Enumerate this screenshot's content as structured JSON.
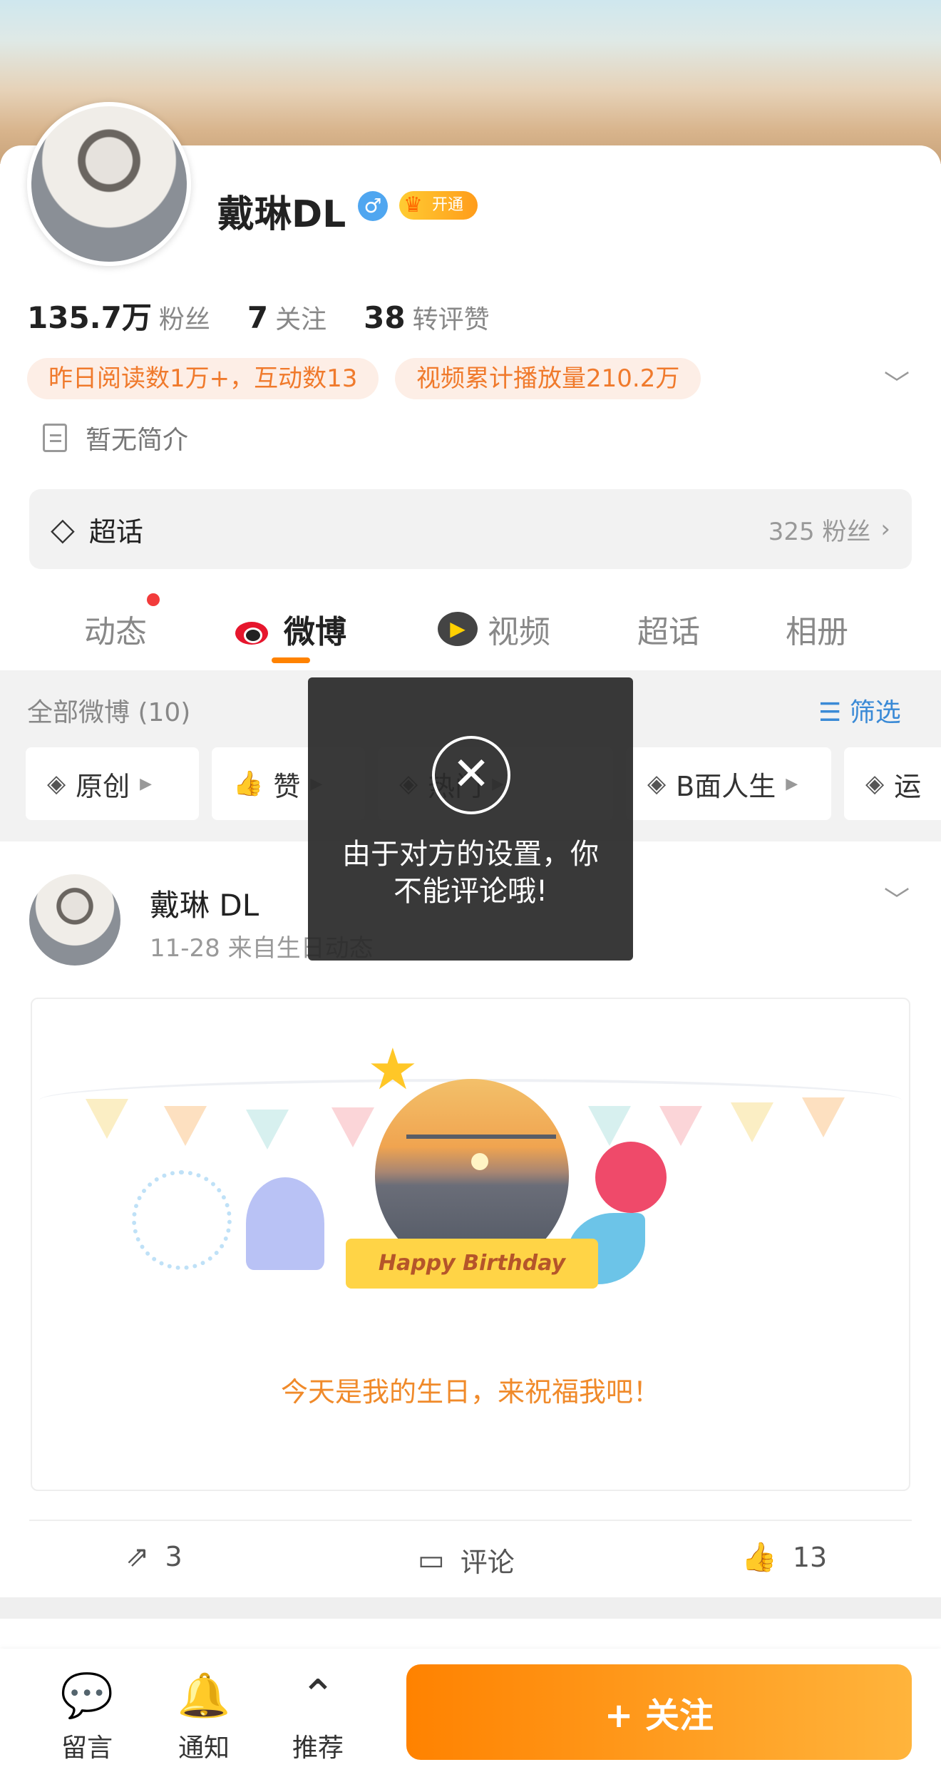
{
  "profile": {
    "name": "戴琳DL",
    "gender_symbol": "♂",
    "vip_label": "开通",
    "stats": [
      {
        "value": "135.7万",
        "label": "粉丝"
      },
      {
        "value": "7",
        "label": "关注"
      },
      {
        "value": "38",
        "label": "转评赞"
      }
    ],
    "tags": [
      "昨日阅读数1万+，互动数13",
      "视频累计播放量210.2万"
    ],
    "bio": "暂无简介",
    "supertopic": {
      "label": "超话",
      "fans": "325 粉丝"
    }
  },
  "tabs": [
    {
      "label": "动态"
    },
    {
      "label": "微博"
    },
    {
      "label": "视频"
    },
    {
      "label": "超话"
    },
    {
      "label": "相册"
    }
  ],
  "filter": {
    "all_label": "全部微博 (10)",
    "filter_label": "筛选",
    "chips": [
      "原创",
      "赞",
      "热门",
      "B面人生",
      "运"
    ]
  },
  "post": {
    "author": "戴琳 DL",
    "meta": "11-28  来自生日动态",
    "card_ribbon": "Happy Birthday",
    "card_text": "今天是我的生日，来祝福我吧！",
    "actions": {
      "repost": "3",
      "comment": "评论",
      "like": "13"
    }
  },
  "toast": {
    "message": "由于对方的设置，你不能评论哦!"
  },
  "bottom_bar": {
    "items": [
      {
        "label": "留言",
        "icon": "message-icon"
      },
      {
        "label": "通知",
        "icon": "bell-icon"
      },
      {
        "label": "推荐",
        "icon": "chevron-up-circle-icon"
      }
    ],
    "follow_label": "+ 关注"
  },
  "colors": {
    "accent": "#ff8200",
    "link": "#3a8ad6",
    "tag_bg": "#fdeee6",
    "tag_text": "#f07a2c"
  }
}
